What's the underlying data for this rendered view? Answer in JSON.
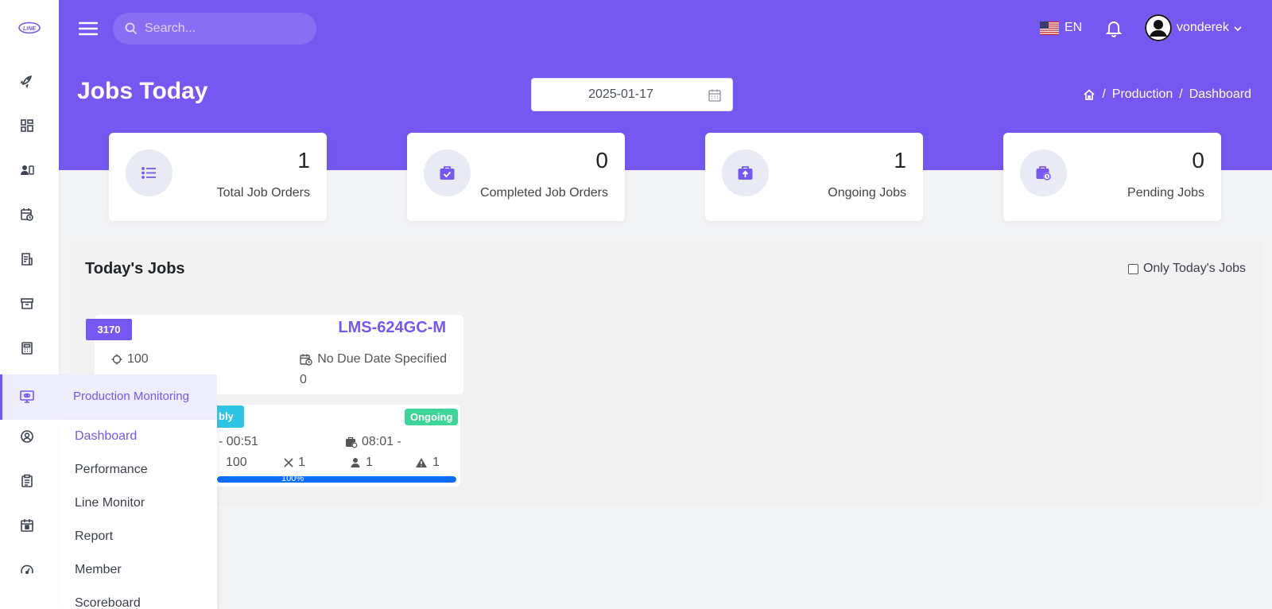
{
  "header": {
    "search_placeholder": "Search...",
    "language": "EN",
    "username": "vonderek",
    "accent_color": "#7557f2"
  },
  "page": {
    "title": "Jobs Today",
    "date": "2025-01-17",
    "breadcrumbs": [
      "Production",
      "Dashboard"
    ]
  },
  "stats": [
    {
      "value": "1",
      "label": "Total Job Orders",
      "icon": "list-icon"
    },
    {
      "value": "0",
      "label": "Completed Job Orders",
      "icon": "briefcase-check-icon"
    },
    {
      "value": "1",
      "label": "Ongoing Jobs",
      "icon": "briefcase-upload-icon"
    },
    {
      "value": "0",
      "label": "Pending Jobs",
      "icon": "briefcase-clock-icon"
    }
  ],
  "sidebar": {
    "icons": [
      "rocket-icon",
      "dashboard-icon",
      "users-icon",
      "calendar-clock-icon",
      "invoice-icon",
      "archive-icon",
      "calculator-icon",
      "monitor-icon",
      "user-circle-icon",
      "clipboard-icon",
      "calendar-icon",
      "speedometer-icon"
    ],
    "active_label": "Production Monitoring",
    "submenu": [
      "Dashboard",
      "Performance",
      "Line Monitor",
      "Report",
      "Member",
      "Scoreboard"
    ]
  },
  "jobs": {
    "title": "Today's Jobs",
    "only_today_label": "Only Today's Jobs",
    "only_today_checked": false,
    "card": {
      "id": "3170",
      "code": "LMS-624GC-M",
      "target": "100",
      "due": "No Due Date Specified",
      "partial_text": "0"
    },
    "stage": {
      "badge_partial": "bly",
      "status": "Ongoing",
      "time_partial": "- 00:51",
      "time_start": "08:01 -",
      "output_partial": "100",
      "rejects": "1",
      "members": "1",
      "issues": "1",
      "progress_percent": 100,
      "progress_label": "100%"
    }
  }
}
